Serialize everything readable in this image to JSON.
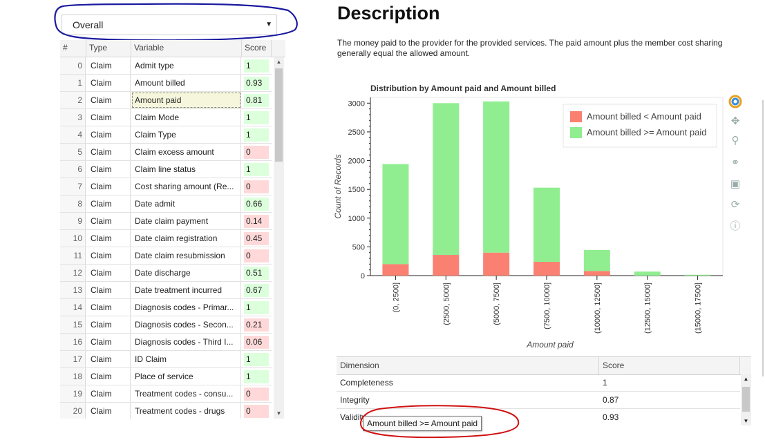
{
  "selector": {
    "value": "Overall"
  },
  "grid": {
    "headers": {
      "index": "#",
      "type": "Type",
      "variable": "Variable",
      "score": "Score"
    },
    "rows": [
      {
        "index": "0",
        "type": "Claim",
        "variable": "Admit type",
        "score": "1",
        "status": "good"
      },
      {
        "index": "1",
        "type": "Claim",
        "variable": "Amount billed",
        "score": "0.93",
        "status": "good"
      },
      {
        "index": "2",
        "type": "Claim",
        "variable": "Amount paid",
        "score": "0.81",
        "status": "good",
        "selected": true
      },
      {
        "index": "3",
        "type": "Claim",
        "variable": "Claim Mode",
        "score": "1",
        "status": "good"
      },
      {
        "index": "4",
        "type": "Claim",
        "variable": "Claim Type",
        "score": "1",
        "status": "good"
      },
      {
        "index": "5",
        "type": "Claim",
        "variable": "Claim excess amount",
        "score": "0",
        "status": "bad"
      },
      {
        "index": "6",
        "type": "Claim",
        "variable": "Claim line status",
        "score": "1",
        "status": "good"
      },
      {
        "index": "7",
        "type": "Claim",
        "variable": "Cost sharing amount (Re...",
        "score": "0",
        "status": "bad"
      },
      {
        "index": "8",
        "type": "Claim",
        "variable": "Date admit",
        "score": "0.66",
        "status": "good"
      },
      {
        "index": "9",
        "type": "Claim",
        "variable": "Date claim payment",
        "score": "0.14",
        "status": "bad"
      },
      {
        "index": "10",
        "type": "Claim",
        "variable": "Date claim registration",
        "score": "0.45",
        "status": "bad"
      },
      {
        "index": "11",
        "type": "Claim",
        "variable": "Date claim resubmission",
        "score": "0",
        "status": "bad"
      },
      {
        "index": "12",
        "type": "Claim",
        "variable": "Date discharge",
        "score": "0.51",
        "status": "good"
      },
      {
        "index": "13",
        "type": "Claim",
        "variable": "Date treatment incurred",
        "score": "0.67",
        "status": "good"
      },
      {
        "index": "14",
        "type": "Claim",
        "variable": "Diagnosis codes - Primar...",
        "score": "1",
        "status": "good"
      },
      {
        "index": "15",
        "type": "Claim",
        "variable": "Diagnosis codes - Secon...",
        "score": "0.21",
        "status": "bad"
      },
      {
        "index": "16",
        "type": "Claim",
        "variable": "Diagnosis codes - Third I...",
        "score": "0.06",
        "status": "bad"
      },
      {
        "index": "17",
        "type": "Claim",
        "variable": "ID Claim",
        "score": "1",
        "status": "good"
      },
      {
        "index": "18",
        "type": "Claim",
        "variable": "Place of service",
        "score": "1",
        "status": "good"
      },
      {
        "index": "19",
        "type": "Claim",
        "variable": "Treatment codes - consu...",
        "score": "0",
        "status": "bad"
      },
      {
        "index": "20",
        "type": "Claim",
        "variable": "Treatment codes - drugs",
        "score": "0",
        "status": "bad"
      }
    ],
    "colors": {
      "good": "#dcffdc",
      "bad": "#ffd9d9"
    }
  },
  "description": {
    "title": "Description",
    "text": "The money paid to the provider for the provided services. The paid amount plus the member cost sharing generally equal the allowed amount."
  },
  "chart_data": {
    "type": "bar",
    "stacked": true,
    "title": "Distribution by Amount paid and Amount billed",
    "xlabel": "Amount paid",
    "ylabel": "Count of Records",
    "categories": [
      "(0, 2500]",
      "(2500, 5000]",
      "(5000, 7500]",
      "(7500, 10000]",
      "(10000, 12500]",
      "(12500, 15000]",
      "(15000, 17500]"
    ],
    "series": [
      {
        "name": "Amount billed < Amount paid",
        "color": "#fa8072",
        "values": [
          200,
          360,
          400,
          240,
          80,
          0,
          0
        ]
      },
      {
        "name": "Amount billed >= Amount paid",
        "color": "#90ee90",
        "values": [
          1740,
          2640,
          2630,
          1290,
          365,
          70,
          15
        ]
      }
    ],
    "ylim": [
      0,
      3100
    ],
    "yticks": [
      0,
      500,
      1000,
      1500,
      2000,
      2500,
      3000
    ],
    "legend_position": "top-right",
    "grid": false
  },
  "toolbar": {
    "icons": [
      "bokeh-logo-icon",
      "pan-icon",
      "box-zoom-icon",
      "wheel-zoom-icon",
      "save-icon",
      "reset-icon",
      "help-icon"
    ]
  },
  "dimensions": {
    "headers": {
      "dimension": "Dimension",
      "score": "Score"
    },
    "rows": [
      {
        "dimension": "Completeness",
        "score": "1"
      },
      {
        "dimension": "Integrity",
        "score": "0.87"
      },
      {
        "dimension": "Validity",
        "score": "0.93"
      }
    ]
  },
  "tooltip": {
    "text": "Amount billed >= Amount paid"
  },
  "annotations": {
    "blue": "#1a1aa0",
    "red": "#d01010"
  }
}
